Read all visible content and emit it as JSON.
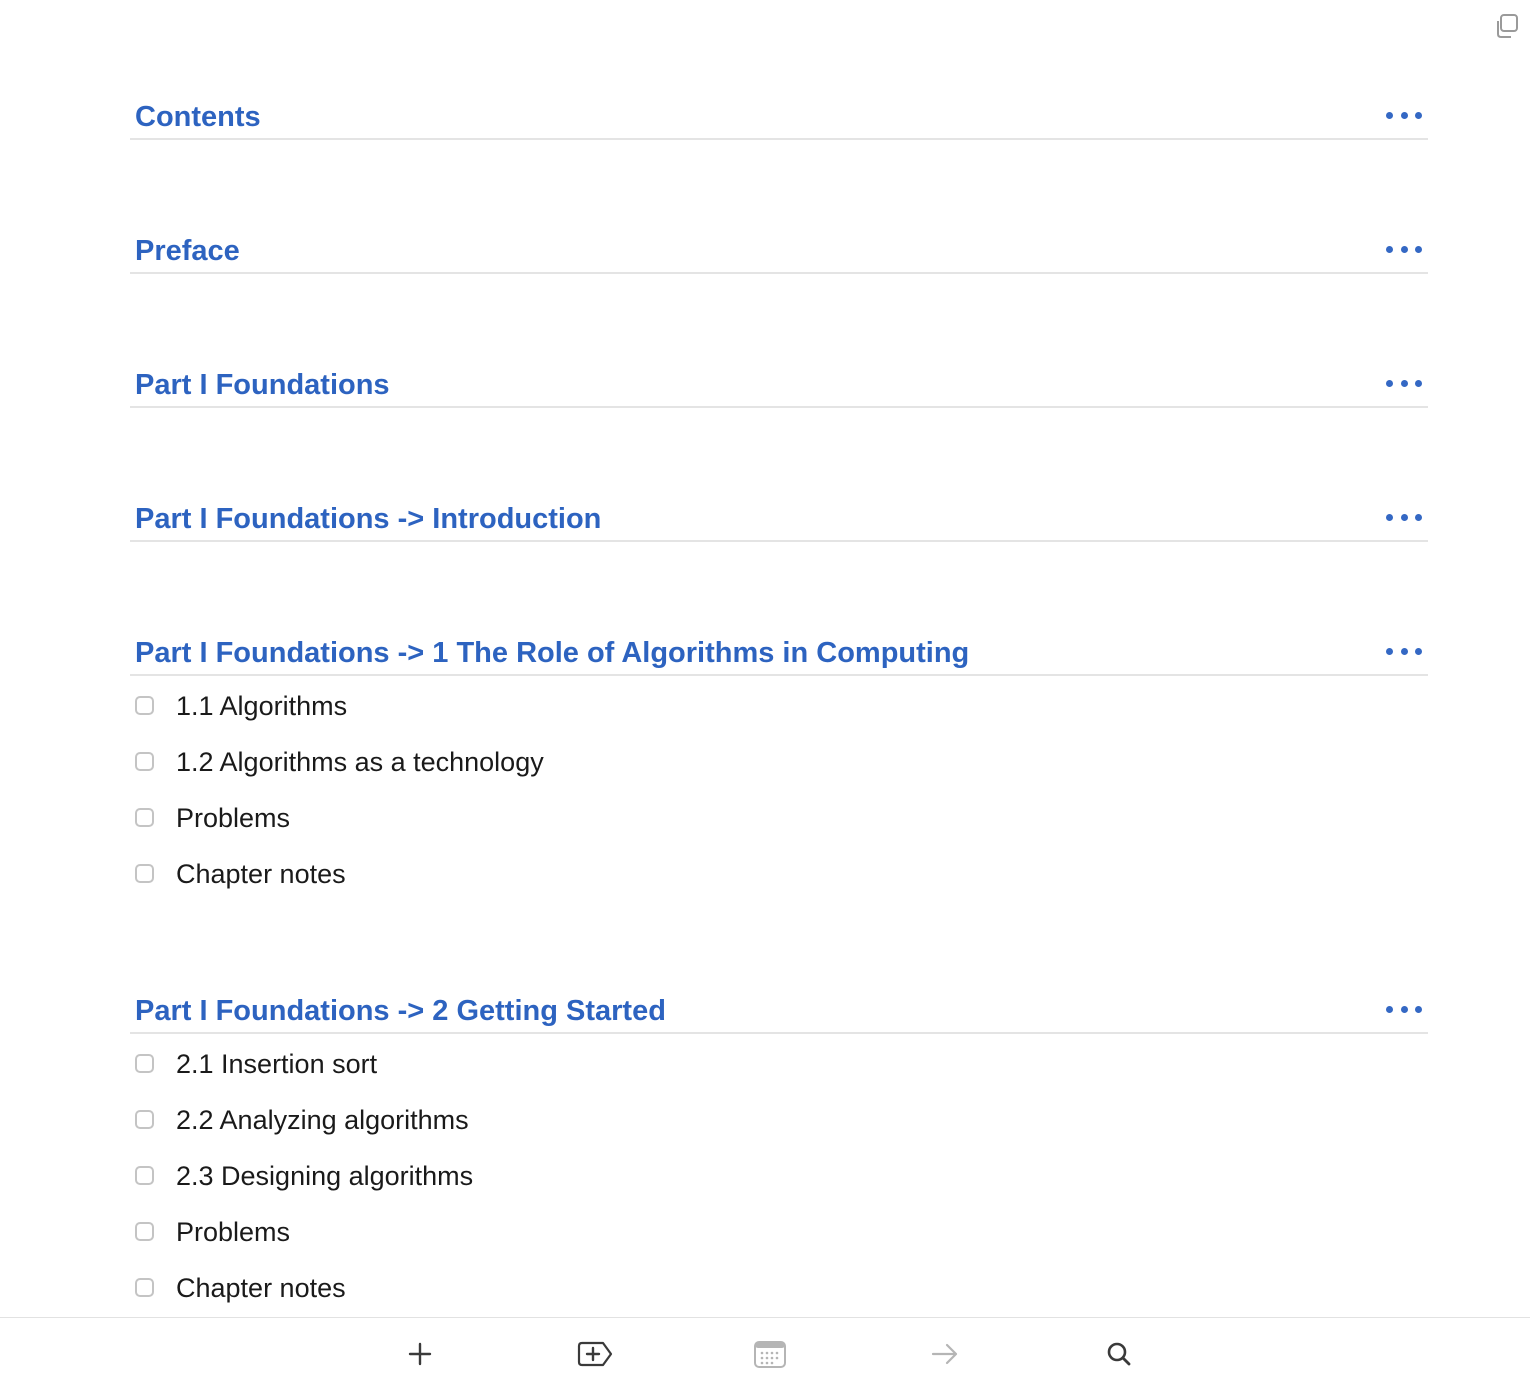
{
  "sections": [
    {
      "title": "Contents",
      "items": []
    },
    {
      "title": "Preface",
      "items": []
    },
    {
      "title": "Part I Foundations",
      "items": []
    },
    {
      "title": "Part I Foundations -> Introduction",
      "items": []
    },
    {
      "title": "Part I Foundations -> 1 The Role of Algorithms in Computing",
      "items": [
        {
          "label": "1.1 Algorithms",
          "checked": false
        },
        {
          "label": "1.2 Algorithms as a technology",
          "checked": false
        },
        {
          "label": "Problems",
          "checked": false
        },
        {
          "label": "Chapter notes",
          "checked": false
        }
      ]
    },
    {
      "title": "Part I Foundations -> 2 Getting Started",
      "items": [
        {
          "label": "2.1 Insertion sort",
          "checked": false
        },
        {
          "label": "2.2 Analyzing algorithms",
          "checked": false
        },
        {
          "label": "2.3 Designing algorithms",
          "checked": false
        },
        {
          "label": "Problems",
          "checked": false
        },
        {
          "label": "Chapter notes",
          "checked": false
        }
      ]
    }
  ],
  "toolbar": {
    "buttons": [
      {
        "icon": "plus-icon"
      },
      {
        "icon": "add-tag-icon"
      },
      {
        "icon": "calendar-icon"
      },
      {
        "icon": "arrow-right-icon"
      },
      {
        "icon": "search-icon"
      }
    ]
  },
  "colors": {
    "heading": "#2d63c0",
    "text": "#1a1a1a",
    "divider": "#e4e4e4"
  }
}
